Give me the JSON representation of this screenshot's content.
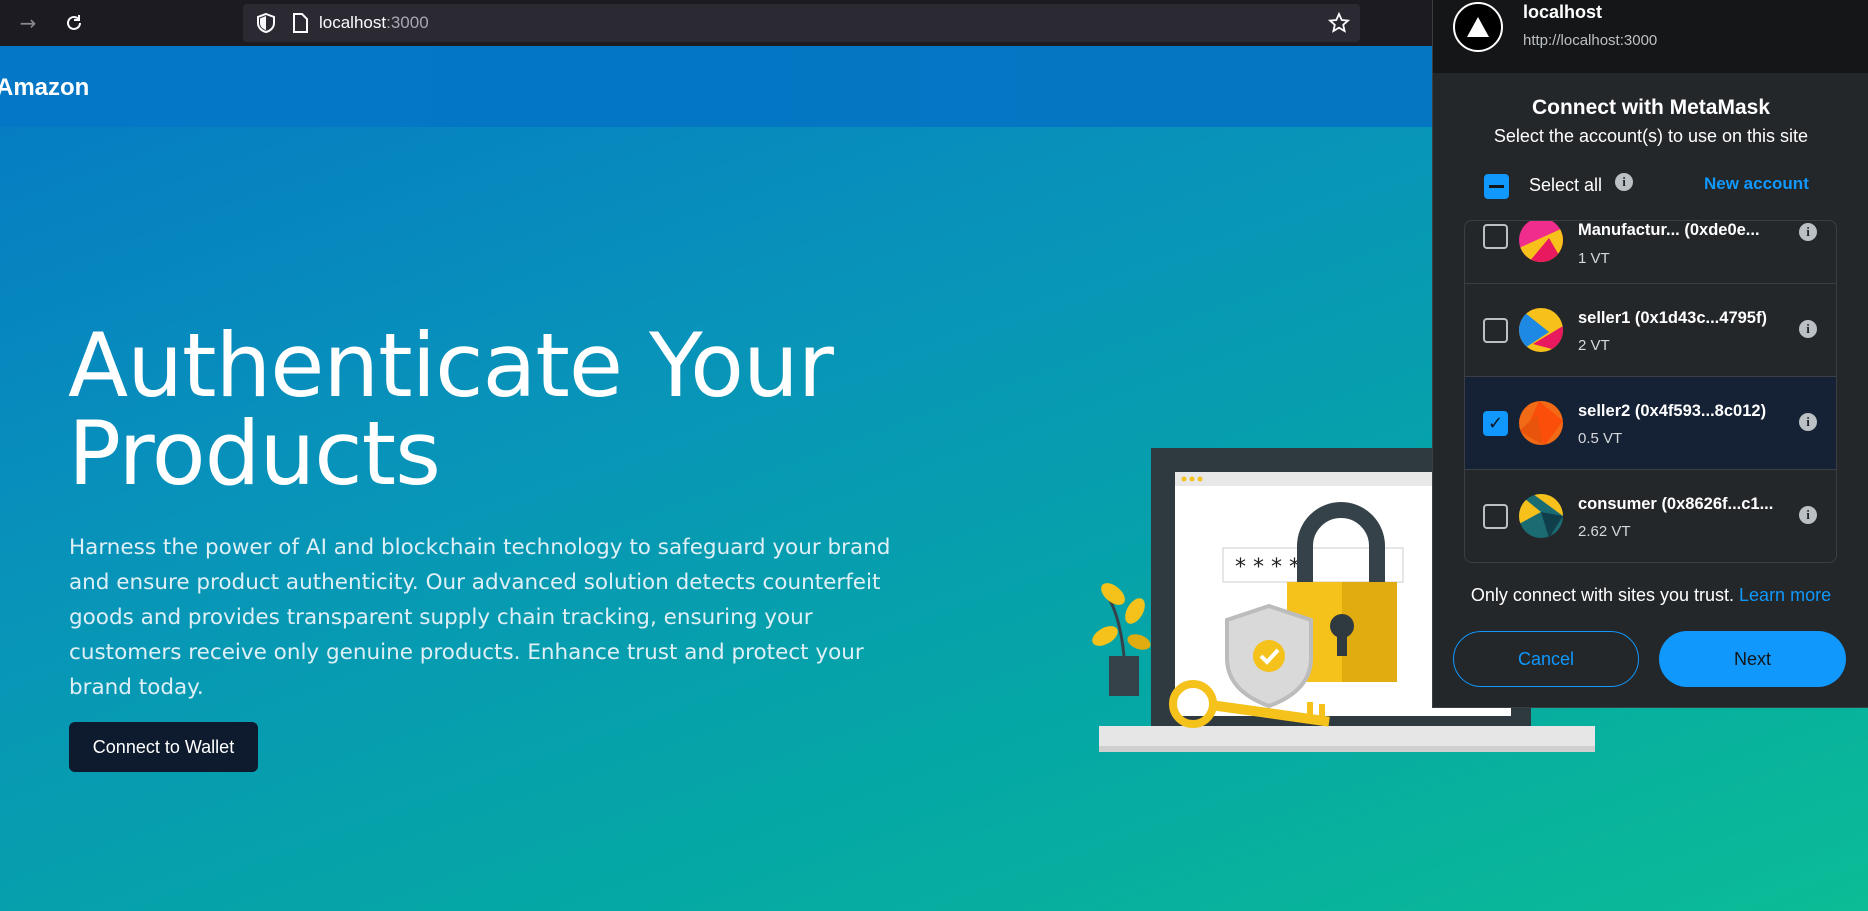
{
  "browser": {
    "url_host": "localhost",
    "url_port": ":3000"
  },
  "page": {
    "brand": "Amazon",
    "hero_title_line1": "Authenticate Your",
    "hero_title_line2": "Products",
    "hero_description": "Harness the power of AI and blockchain technology to safeguard your brand and ensure product authenticity. Our advanced solution detects counterfeit goods and provides transparent supply chain tracking, ensuring your customers receive only genuine products. Enhance trust and protect your brand today.",
    "connect_button": "Connect to Wallet"
  },
  "metamask": {
    "site_name": "localhost",
    "site_url": "http://localhost:3000",
    "title": "Connect with MetaMask",
    "subtitle": "Select the account(s) to use on this site",
    "select_all": "Select all",
    "new_account": "New account",
    "accounts": [
      {
        "name": "Manufactur... (0xde0e...",
        "balance": "1 VT",
        "checked": false
      },
      {
        "name": "seller1 (0x1d43c...4795f)",
        "balance": "2 VT",
        "checked": false
      },
      {
        "name": "seller2 (0x4f593...8c012)",
        "balance": "0.5 VT",
        "checked": true
      },
      {
        "name": "consumer (0x8626f...c1...",
        "balance": "2.62 VT",
        "checked": false
      }
    ],
    "trust_text": "Only connect with sites you trust.",
    "learn_more": "Learn more",
    "cancel": "Cancel",
    "next": "Next"
  },
  "colors": {
    "metamask_blue": "#1098fc",
    "popup_bg": "#24272a",
    "button_dark": "#0e1a2e"
  }
}
